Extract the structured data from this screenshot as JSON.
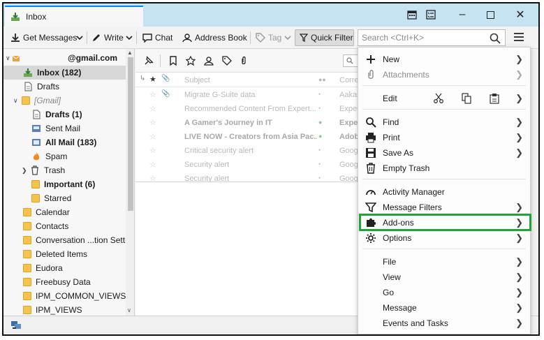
{
  "titlebar": {
    "tab_label": "Inbox",
    "window_controls": [
      "minimize",
      "maximize",
      "close"
    ]
  },
  "toolbar": {
    "get_messages": "Get Messages",
    "write": "Write",
    "chat": "Chat",
    "address_book": "Address Book",
    "tag": "Tag",
    "quick_filter": "Quick Filter",
    "search_placeholder": "Search <Ctrl+K>"
  },
  "folders": {
    "account": "@gmail.com",
    "items": [
      {
        "label": "Inbox (182)",
        "bold": true,
        "selected": true
      },
      {
        "label": "Drafts"
      },
      {
        "label": "[Gmail]",
        "italic": true
      },
      {
        "label": "Drafts (1)",
        "bold": true
      },
      {
        "label": "Sent Mail"
      },
      {
        "label": "All Mail (183)",
        "bold": true
      },
      {
        "label": "Spam"
      },
      {
        "label": "Trash"
      },
      {
        "label": "Important (6)",
        "bold": true
      },
      {
        "label": "Starred"
      },
      {
        "label": "Calendar"
      },
      {
        "label": "Contacts"
      },
      {
        "label": "Conversation ...tion Settin"
      },
      {
        "label": "Deleted Items"
      },
      {
        "label": "Eudora"
      },
      {
        "label": "Freebusy Data"
      },
      {
        "label": "IPM_COMMON_VIEWS"
      },
      {
        "label": "IPM_VIEWS"
      }
    ]
  },
  "messages": {
    "header_subject": "Subject",
    "header_corr": "Corre",
    "rows": [
      {
        "subject": "Migrate G-Suite data",
        "corr": "Aakas",
        "bold": false
      },
      {
        "subject": "Recommended Content From Expert...",
        "corr": "Exper",
        "bold": false
      },
      {
        "subject": "A Gamer's Journey in IT",
        "corr": "Exper",
        "bold": true
      },
      {
        "subject": "LIVE NOW - Creators from Asia Pac...",
        "corr": "Adob",
        "bold": true
      },
      {
        "subject": "Critical security alert",
        "corr": "Goog",
        "bold": false
      },
      {
        "subject": "Security alert",
        "corr": "Goog",
        "bold": false
      },
      {
        "subject": "Security alert",
        "corr": "Goog",
        "bold": false
      }
    ]
  },
  "menu": {
    "new": "New",
    "attachments": "Attachments",
    "edit": "Edit",
    "find": "Find",
    "print": "Print",
    "save_as": "Save As",
    "empty_trash": "Empty Trash",
    "activity_manager": "Activity Manager",
    "message_filters": "Message Filters",
    "add_ons": "Add-ons",
    "options": "Options",
    "file": "File",
    "view": "View",
    "go": "Go",
    "message": "Message",
    "events_tasks": "Events and Tasks"
  },
  "colors": {
    "titlebar": "#c6e3f2",
    "highlight_border": "#22a33a",
    "folder": "#f5c24b"
  }
}
